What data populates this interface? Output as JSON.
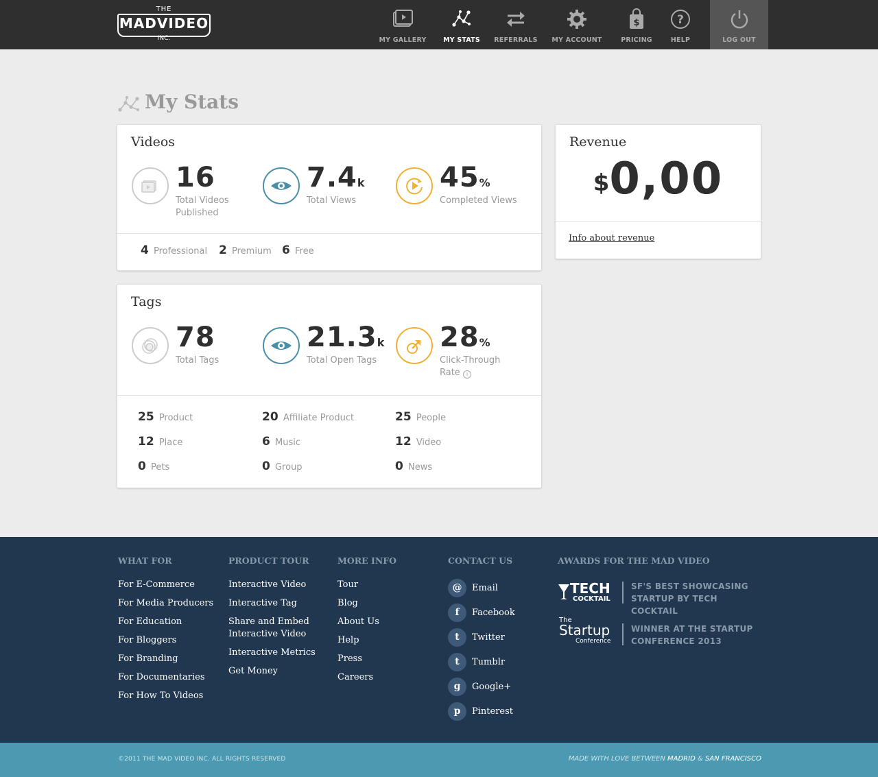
{
  "header": {
    "logo": {
      "the": "THE",
      "name": "MADVIDEO",
      "inc": "INC."
    },
    "nav": [
      {
        "label": "MY GALLERY",
        "icon": "gallery-icon"
      },
      {
        "label": "MY STATS",
        "icon": "stats-icon",
        "active": true
      },
      {
        "label": "REFERRALS",
        "icon": "referrals-icon"
      },
      {
        "label": "MY ACCOUNT",
        "icon": "gear-icon"
      },
      {
        "label": "PRICING",
        "icon": "price-tag-icon"
      },
      {
        "label": "HELP",
        "icon": "help-icon"
      },
      {
        "label": "LOG OUT",
        "icon": "power-icon"
      }
    ]
  },
  "page": {
    "title": "My Stats",
    "title_icon": "stats-icon"
  },
  "videos": {
    "title": "Videos",
    "stats": [
      {
        "value": "16",
        "unit": "",
        "label": "Total Videos Published",
        "icon": "video-stack-icon"
      },
      {
        "value": "7.4",
        "unit": "k",
        "label": "Total Views",
        "icon": "eye-icon"
      },
      {
        "value": "45",
        "unit": "%",
        "label": "Completed Views",
        "icon": "replay-icon"
      }
    ],
    "breakdown": [
      {
        "count": "4",
        "label": "Professional"
      },
      {
        "count": "2",
        "label": "Premium"
      },
      {
        "count": "6",
        "label": "Free"
      }
    ]
  },
  "tags": {
    "title": "Tags",
    "stats": [
      {
        "value": "78",
        "unit": "",
        "label": "Total Tags",
        "icon": "tag-circles-icon"
      },
      {
        "value": "21.3",
        "unit": "k",
        "label": "Total Open Tags",
        "icon": "eye-icon"
      },
      {
        "value": "28",
        "unit": "%",
        "label": "Click-Through Rate",
        "icon": "share-arrow-icon"
      }
    ],
    "breakdown": [
      {
        "count": "25",
        "label": "Product"
      },
      {
        "count": "20",
        "label": "Affiliate Product"
      },
      {
        "count": "25",
        "label": "People"
      },
      {
        "count": "12",
        "label": "Place"
      },
      {
        "count": "6",
        "label": "Music"
      },
      {
        "count": "12",
        "label": "Video"
      },
      {
        "count": "0",
        "label": "Pets"
      },
      {
        "count": "0",
        "label": "Group"
      },
      {
        "count": "0",
        "label": "News"
      }
    ]
  },
  "revenue": {
    "title": "Revenue",
    "currency": "$",
    "amount": "0,00",
    "link": "Info about revenue"
  },
  "footer": {
    "what_for": {
      "heading": "WHAT FOR",
      "links": [
        "For E-Commerce",
        "For Media Producers",
        "For Education",
        "For Bloggers",
        "For Branding",
        "For Documentaries",
        "For How To Videos"
      ]
    },
    "product_tour": {
      "heading": "PRODUCT TOUR",
      "links": [
        "Interactive Video",
        "Interactive Tag",
        "Share and Embed Interactive Video",
        "Interactive Metrics",
        "Get Money"
      ]
    },
    "more_info": {
      "heading": "MORE INFO",
      "links": [
        "Tour",
        "Blog",
        "About Us",
        "Help",
        "Press",
        "Careers"
      ]
    },
    "contact": {
      "heading": "CONTACT US",
      "links": [
        {
          "label": "Email",
          "glyph": "@",
          "icon": "email-icon"
        },
        {
          "label": "Facebook",
          "glyph": "f",
          "icon": "facebook-icon"
        },
        {
          "label": "Twitter",
          "glyph": "t",
          "icon": "twitter-icon"
        },
        {
          "label": "Tumblr",
          "glyph": "t",
          "icon": "tumblr-icon"
        },
        {
          "label": "Google+",
          "glyph": "g",
          "icon": "google-plus-icon"
        },
        {
          "label": "Pinterest",
          "glyph": "p",
          "icon": "pinterest-icon"
        }
      ]
    },
    "awards": {
      "heading": "AWARDS FOR THE MAD VIDEO",
      "items": [
        {
          "logo_line1": "TECH",
          "logo_line2": "COCKTAIL",
          "text_line1": "SF'S BEST SHOWCASING",
          "text_line2": "STARTUP BY TECH COCKTAIL"
        },
        {
          "logo_line0": "The",
          "logo_line1": "Startup",
          "logo_line2": "Conference",
          "text_line1": "WINNER AT THE STARTUP",
          "text_line2": "CONFERENCE 2013"
        }
      ]
    },
    "copyright": "©2011 THE MAD VIDEO INC. ALL RIGHTS RESERVED",
    "made_with": "MADE WITH LOVE BETWEEN",
    "city1": "MADRID",
    "amp": "&",
    "city2": "SAN FRANCISCO"
  },
  "colors": {
    "header_bg": "#2f2f2f",
    "accent_blue": "#4a8fa8",
    "accent_orange": "#f2b035",
    "footer_bg": "#20374f",
    "bottombar_bg": "#4c9ab2"
  }
}
